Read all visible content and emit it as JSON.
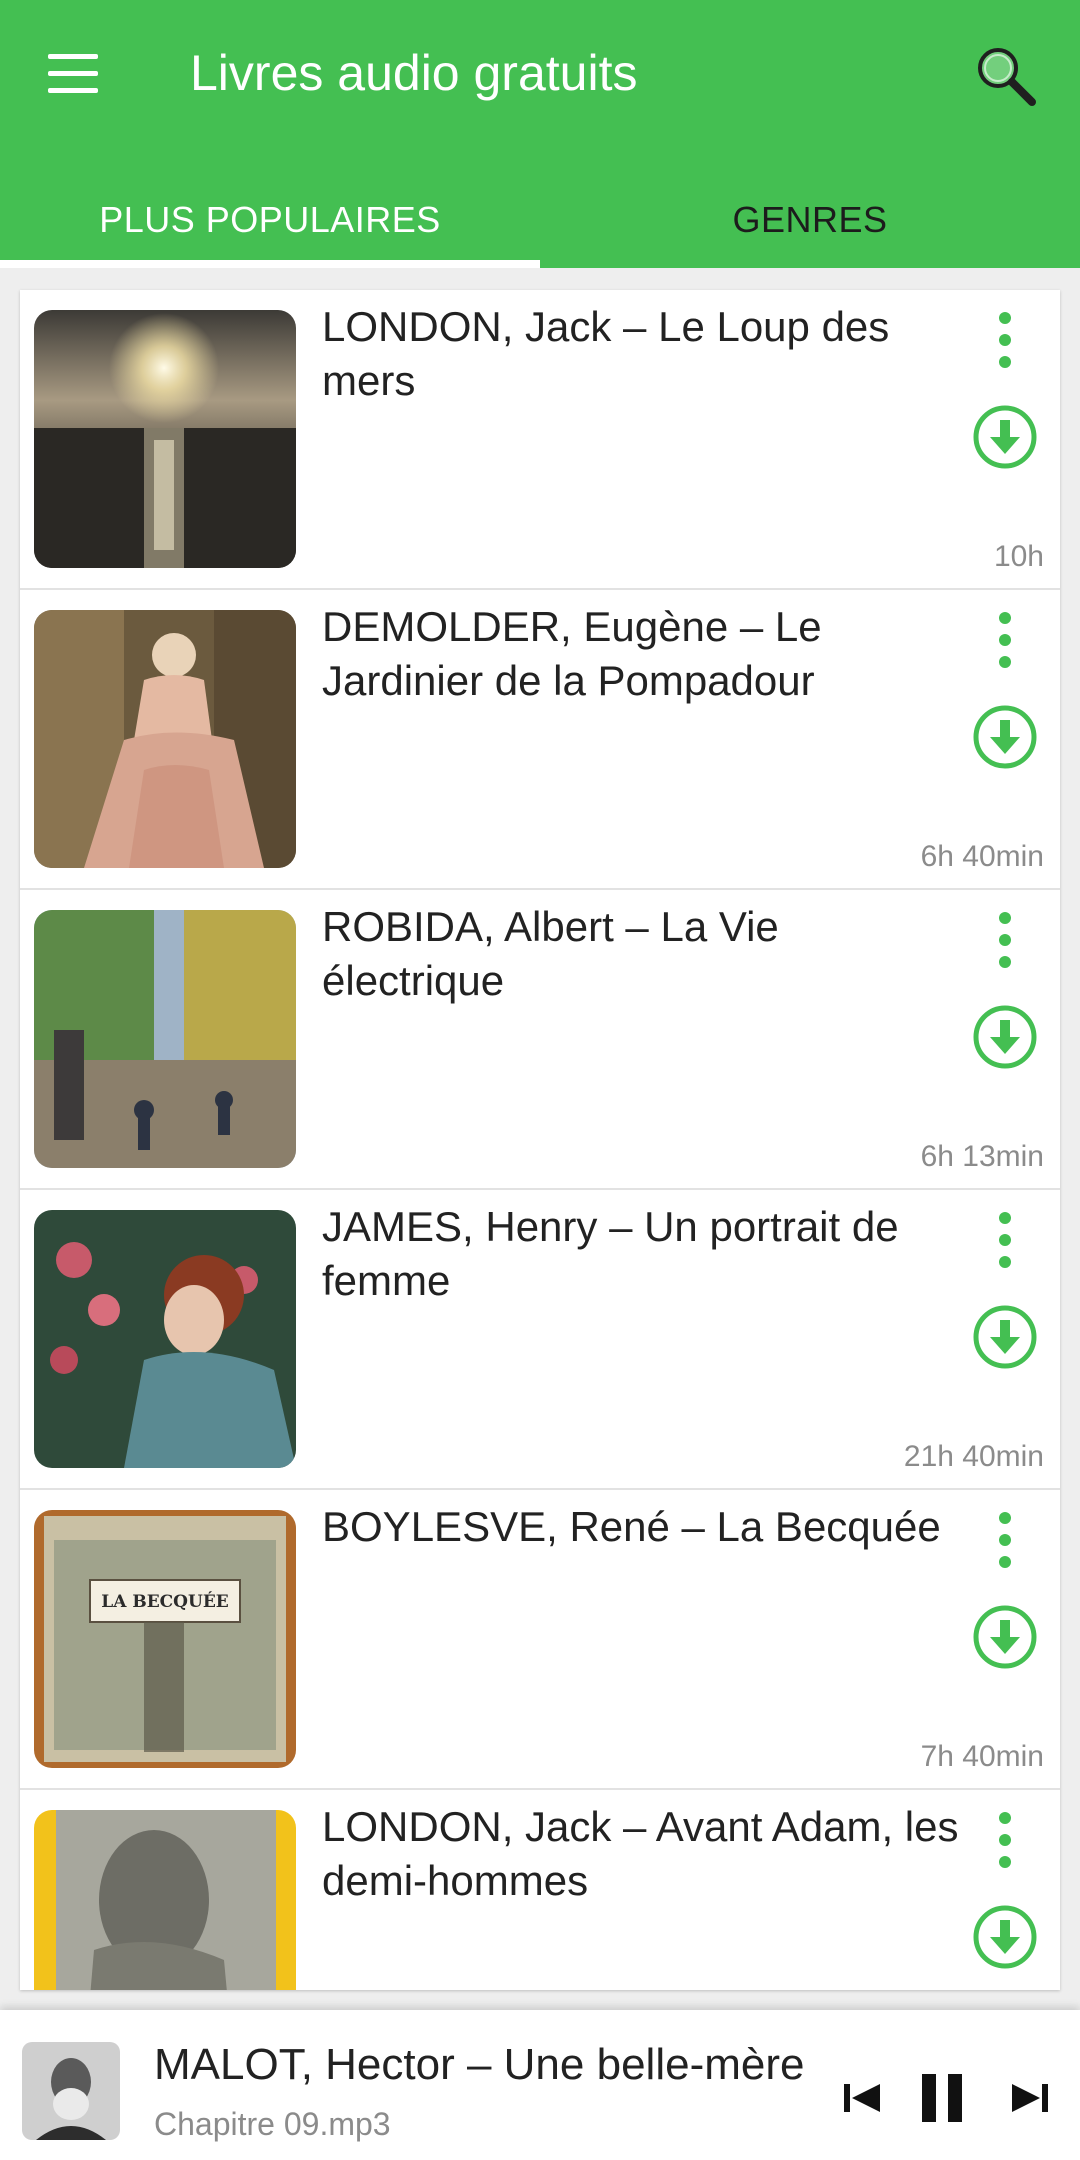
{
  "app": {
    "title": "Livres audio gratuits",
    "accent_color": "#44bf52",
    "menu_icon": "hamburger-menu-icon",
    "search_icon": "search-icon"
  },
  "tabs": [
    {
      "label": "PLUS POPULAIRES",
      "selected": true
    },
    {
      "label": "GENRES",
      "selected": false
    }
  ],
  "books": [
    {
      "title": "LONDON, Jack – Le Loup des mers",
      "duration": "10h",
      "thumb": "sunset-sea"
    },
    {
      "title": "DEMOLDER, Eugène – Le Jardinier de la Pompadour",
      "duration": "6h 40min",
      "thumb": "pompadour-painting"
    },
    {
      "title": "ROBIDA, Albert – La Vie électrique",
      "duration": "6h 13min",
      "thumb": "street-painting"
    },
    {
      "title": "JAMES, Henry – Un portrait de femme",
      "duration": "21h 40min",
      "thumb": "woman-roses-painting"
    },
    {
      "title": "BOYLESVE, René – La Becquée",
      "duration": "7h 40min",
      "thumb": "book-cover-la-becquee",
      "cover_text": "LA BECQUÉE"
    },
    {
      "title": "LONDON, Jack – Avant Adam, les demi-hommes",
      "duration": "",
      "thumb": "ape-illustration"
    }
  ],
  "player": {
    "title": "MALOT, Hector – Une belle-mère",
    "subtitle": "Chapitre 09.mp3",
    "controls": [
      "skip-previous-icon",
      "pause-icon",
      "skip-next-icon"
    ]
  }
}
